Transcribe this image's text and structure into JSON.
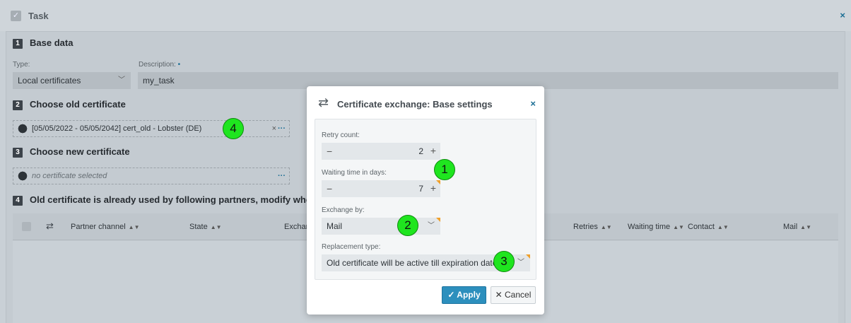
{
  "window": {
    "title": "Task",
    "close": "×"
  },
  "sections": {
    "base": {
      "num": "1",
      "title": "Base data"
    },
    "old_cert": {
      "num": "2",
      "title": "Choose old certificate"
    },
    "new_cert": {
      "num": "3",
      "title": "Choose new certificate"
    },
    "partners": {
      "num": "4",
      "title": "Old certificate is already used by following partners, modify where ne"
    }
  },
  "base": {
    "type_label": "Type:",
    "type_value": "Local certificates",
    "desc_label": "Description:",
    "desc_required": "•",
    "desc_value": "my_task"
  },
  "old_certificate": {
    "value": "[05/05/2022 - 05/05/2042] cert_old - Lobster (DE)",
    "clear": "×",
    "more": "···"
  },
  "new_certificate": {
    "placeholder": "no certificate selected",
    "more": "···"
  },
  "table": {
    "columns": [
      "Partner channel",
      "State",
      "Exchan",
      "Retries",
      "Waiting time",
      "Contact",
      "Mail"
    ],
    "sort_icon": "▲▼"
  },
  "modal": {
    "title": "Certificate exchange: Base settings",
    "close": "×",
    "retry_label": "Retry count:",
    "retry_value": "2",
    "wait_label": "Waiting time in days:",
    "wait_value": "7",
    "exchange_label": "Exchange by:",
    "exchange_value": "Mail",
    "replacement_label": "Replacement type:",
    "replacement_value": "Old certificate will be active till expiration date",
    "apply": "Apply",
    "cancel": "Cancel"
  },
  "markers": [
    "1",
    "2",
    "3",
    "4"
  ],
  "colors": {
    "accent": "#2c8fbd",
    "marker": "#1fe51f",
    "required": "#f0a02a"
  }
}
